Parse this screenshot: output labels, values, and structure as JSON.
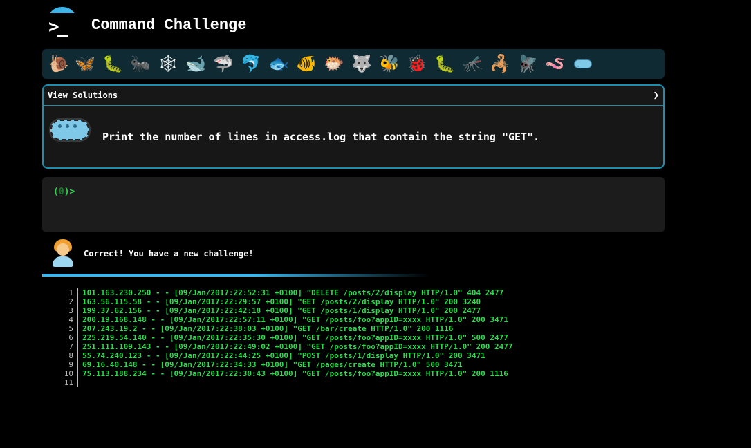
{
  "header": {
    "logo_icon": "terminal-prompt-icon",
    "prompt_glyph": ">_",
    "title": "Command Challenge"
  },
  "creatures": [
    {
      "name": "snail",
      "glyph": "🐌"
    },
    {
      "name": "butterfly",
      "glyph": "🦋"
    },
    {
      "name": "caterpillar",
      "glyph": "🐛"
    },
    {
      "name": "ant",
      "glyph": "🐜"
    },
    {
      "name": "spider-web",
      "glyph": "🕸"
    },
    {
      "name": "whale",
      "glyph": "🐋"
    },
    {
      "name": "shark",
      "glyph": "🦈"
    },
    {
      "name": "dolphin",
      "glyph": "🐬"
    },
    {
      "name": "fish",
      "glyph": "🐟"
    },
    {
      "name": "tropical-fish",
      "glyph": "🐠"
    },
    {
      "name": "blowfish",
      "glyph": "🐡"
    },
    {
      "name": "wolf",
      "glyph": "🐺"
    },
    {
      "name": "bee",
      "glyph": "🐝"
    },
    {
      "name": "ladybug",
      "glyph": "🐞"
    },
    {
      "name": "worm",
      "glyph": "🐛"
    },
    {
      "name": "mosquito",
      "glyph": "🦟"
    },
    {
      "name": "scorpion",
      "glyph": "🦂"
    },
    {
      "name": "fly",
      "glyph": "🪰"
    },
    {
      "name": "worm-pink",
      "glyph": "🪱"
    },
    {
      "name": "microbe",
      "glyph": ""
    }
  ],
  "challenge": {
    "view_solutions_label": "View Solutions",
    "chevron": "❯",
    "icon": "microbe-icon",
    "text": "Print the number of lines in access.log that contain the string \"GET\"."
  },
  "terminal": {
    "prompt_open": "(",
    "count": "0",
    "prompt_close": ")>"
  },
  "result": {
    "avatar_icon": "person-icon",
    "message": "Correct! You have a new challenge!"
  },
  "file_lines": [
    {
      "n": "1",
      "text": "101.163.230.250 - - [09/Jan/2017:22:52:31 +0100] \"DELETE /posts/2/display HTTP/1.0\" 404 2477"
    },
    {
      "n": "2",
      "text": "163.56.115.58 - - [09/Jan/2017:22:29:57 +0100] \"GET /posts/2/display HTTP/1.0\" 200 3240"
    },
    {
      "n": "3",
      "text": "199.37.62.156 - - [09/Jan/2017:22:42:18 +0100] \"GET /posts/1/display HTTP/1.0\" 200 2477"
    },
    {
      "n": "4",
      "text": "200.19.168.148 - - [09/Jan/2017:22:57:11 +0100] \"GET /posts/foo?appID=xxxx HTTP/1.0\" 200 3471"
    },
    {
      "n": "5",
      "text": "207.243.19.2 - - [09/Jan/2017:22:38:03 +0100] \"GET /bar/create HTTP/1.0\" 200 1116"
    },
    {
      "n": "6",
      "text": "225.219.54.140 - - [09/Jan/2017:22:35:30 +0100] \"GET /posts/foo?appID=xxxx HTTP/1.0\" 500 2477"
    },
    {
      "n": "7",
      "text": "251.111.109.143 - - [09/Jan/2017:22:49:02 +0100] \"GET /posts/foo?appID=xxxx HTTP/1.0\" 200 2477"
    },
    {
      "n": "8",
      "text": "55.74.240.123 - - [09/Jan/2017:22:44:25 +0100] \"POST /posts/1/display HTTP/1.0\" 200 3471"
    },
    {
      "n": "9",
      "text": "69.16.40.148 - - [09/Jan/2017:22:34:33 +0100] \"GET /pages/create HTTP/1.0\" 500 3471"
    },
    {
      "n": "10",
      "text": "75.113.188.234 - - [09/Jan/2017:22:30:43 +0100] \"GET /posts/foo?appID=xxxx HTTP/1.0\" 200 1116"
    },
    {
      "n": "11",
      "text": ""
    }
  ]
}
